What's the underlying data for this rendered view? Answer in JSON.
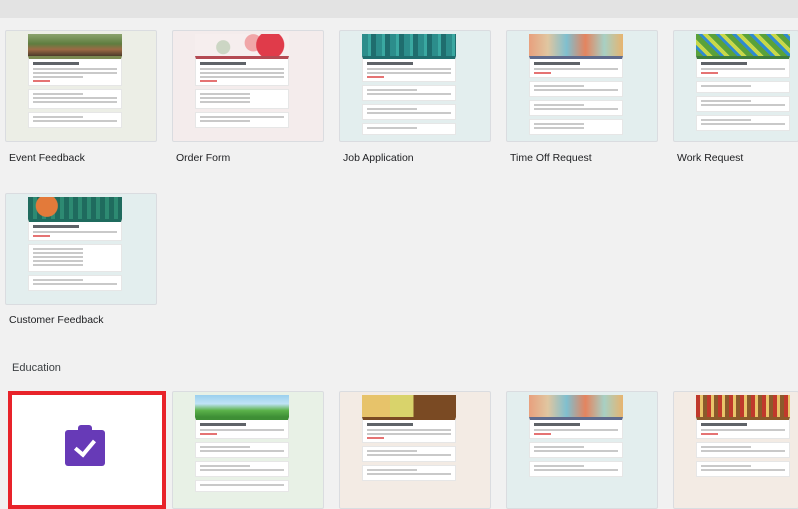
{
  "templates_row1": [
    {
      "label": "Event Feedback",
      "accent": "#7c8a52"
    },
    {
      "label": "Order Form",
      "accent": "#b44a53"
    },
    {
      "label": "Job Application",
      "accent": "#1f6d6e"
    },
    {
      "label": "Time Off Request",
      "accent": "#5f6b8d"
    },
    {
      "label": "Work Request",
      "accent": "#3f7d3c"
    }
  ],
  "templates_row2": [
    {
      "label": "Customer Feedback",
      "accent": "#1f6b5e"
    }
  ],
  "education": {
    "section_title": "Education",
    "blank_icon": "clipboard-check-icon",
    "blank_icon_color": "#673ab7",
    "highlight_color": "#e8232a"
  },
  "colors": {
    "background": "#f1f1f1",
    "card_tint_event": "#eceee6",
    "card_tint_order": "#f4ecec",
    "card_tint_teal": "#e3eeee"
  }
}
